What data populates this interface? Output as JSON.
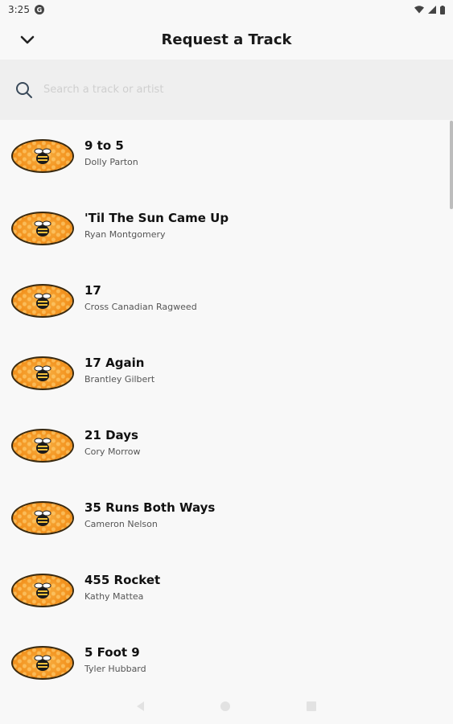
{
  "status_bar": {
    "time": "3:25",
    "notif_icon": "g-icon"
  },
  "header": {
    "title": "Request a Track",
    "back_icon": "chevron-down-icon"
  },
  "search": {
    "placeholder": "Search a track or artist",
    "value": ""
  },
  "tracks": [
    {
      "title": " 9 to 5",
      "artist": "Dolly Parton"
    },
    {
      "title": "'Til The Sun Came Up",
      "artist": "Ryan Montgomery"
    },
    {
      "title": "17",
      "artist": "Cross Canadian Ragweed"
    },
    {
      "title": "17 Again",
      "artist": "Brantley Gilbert"
    },
    {
      "title": "21 Days",
      "artist": "Cory Morrow"
    },
    {
      "title": "35 Runs Both Ways",
      "artist": "Cameron Nelson"
    },
    {
      "title": "455 Rocket",
      "artist": "Kathy Mattea"
    },
    {
      "title": "5 Foot 9",
      "artist": "Tyler Hubbard"
    }
  ],
  "colors": {
    "logo_orange": "#f39420",
    "search_bg": "#efefef"
  }
}
